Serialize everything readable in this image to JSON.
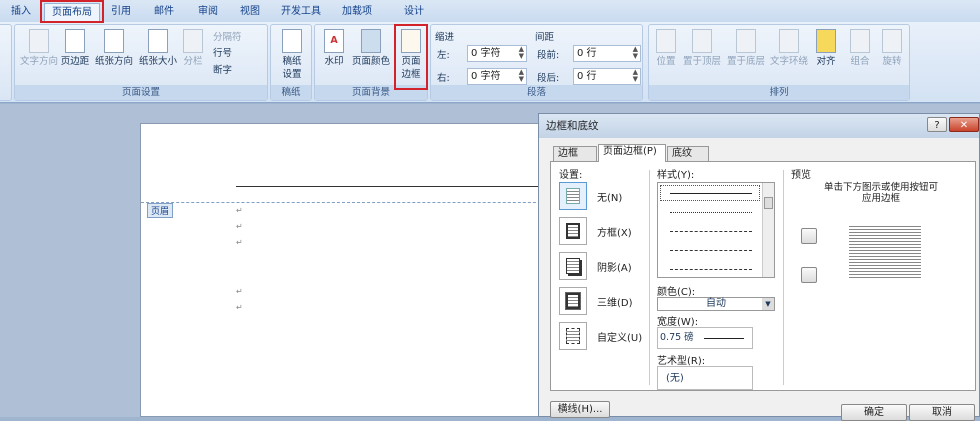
{
  "ribbon_tabs": [
    "插入",
    "页面布局",
    "引用",
    "邮件",
    "审阅",
    "视图",
    "开发工具",
    "加载项",
    "设计"
  ],
  "active_tab": "页面布局",
  "groups": {
    "page_setup": {
      "label": "页面设置",
      "buttons": [
        "文字方向",
        "页边距",
        "纸张方向",
        "纸张大小",
        "分栏"
      ],
      "small": [
        "分隔符",
        "行号",
        "断字"
      ]
    },
    "draft": {
      "label": "稿纸",
      "button": "稿纸\n设置",
      "l1": "稿纸",
      "l2": "设置"
    },
    "page_bg": {
      "label": "页面背景",
      "buttons": [
        "水印",
        "页面颜色"
      ],
      "border_l1": "页面",
      "border_l2": "边框"
    },
    "paragraph": {
      "label": "段落",
      "indent": "缩进",
      "spacing": "间距",
      "left_label": "左:",
      "right_label": "右:",
      "left_value": "0 字符",
      "right_value": "0 字符",
      "before_label": "段前:",
      "after_label": "段后:",
      "before_value": "0 行",
      "after_value": "0 行"
    },
    "arrange": {
      "label": "排列",
      "buttons": [
        "位置",
        "置于顶层",
        "置于底层",
        "文字环绕",
        "对齐",
        "组合",
        "旋转"
      ]
    }
  },
  "document": {
    "header_tag": "页眉",
    "para_mark": "↵"
  },
  "dialog": {
    "title": "边框和底纹",
    "help": "?",
    "close": "✕",
    "tabs": [
      "边框(B)",
      "页面边框(P)",
      "底纹(S)"
    ],
    "settings_label": "设置:",
    "settings": [
      "无(N)",
      "方框(X)",
      "阴影(A)",
      "三维(D)",
      "自定义(U)"
    ],
    "style_label": "样式(Y):",
    "color_label": "颜色(C):",
    "color_value": "自动",
    "width_label": "宽度(W):",
    "width_value": "0.75 磅",
    "art_label": "艺术型(R):",
    "art_value": "(无)",
    "preview_label": "预览",
    "preview_hint": "单击下方图示或使用按钮可应用边框",
    "hline_button": "横线(H)...",
    "ok": "确定",
    "cancel": "取消"
  }
}
